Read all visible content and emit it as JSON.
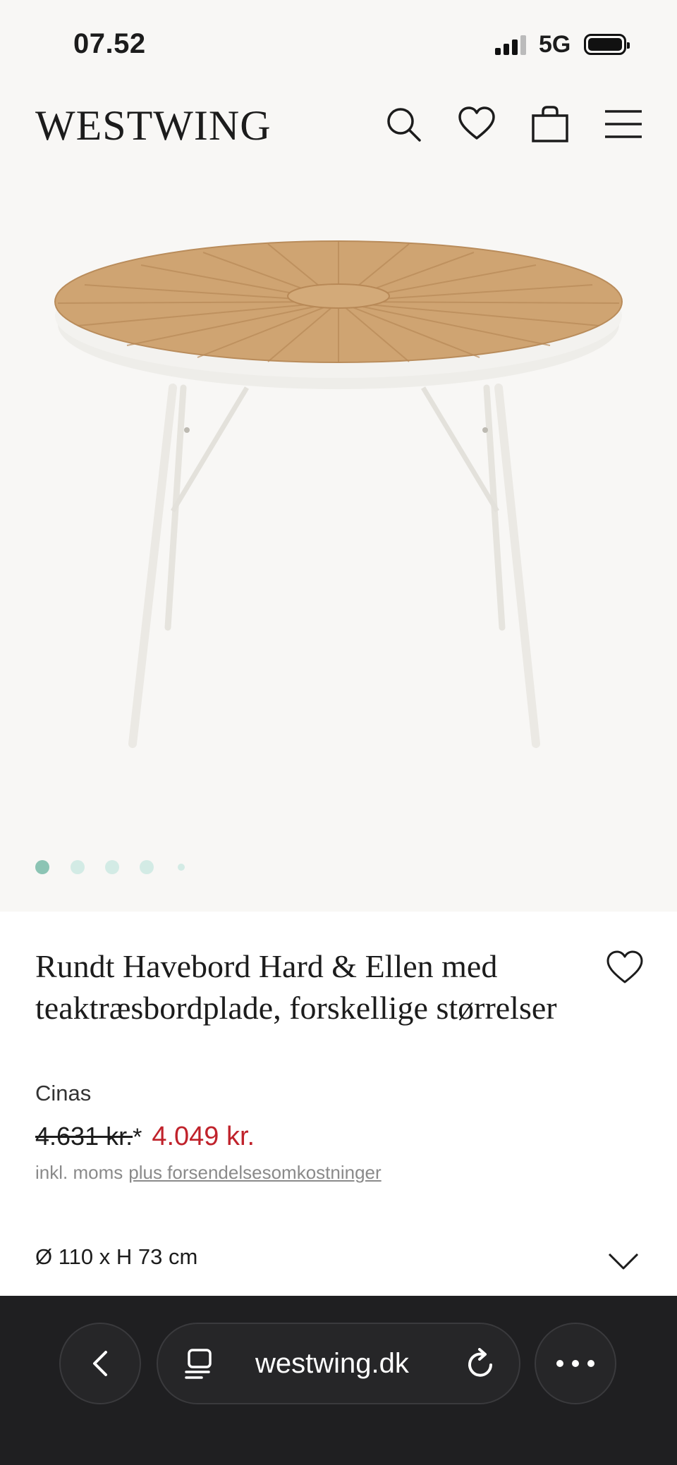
{
  "status_bar": {
    "time": "07.52",
    "network": "5G"
  },
  "header": {
    "logo": "WESTWING",
    "icons": [
      "search-icon",
      "heart-icon",
      "bag-icon",
      "menu-icon"
    ]
  },
  "gallery": {
    "image_count": 5,
    "active_index": 0
  },
  "product": {
    "title": "Rundt Havebord Hard & Ellen med teaktræsbordplade, forskellige størrelser",
    "brand": "Cinas",
    "old_price": "4.631 kr.",
    "old_price_marker": "*",
    "new_price": "4.049 kr.",
    "tax_note": "inkl. moms",
    "shipping_link": "plus forsendelsesomkostninger",
    "size": "Ø 110 x H 73 cm"
  },
  "browser": {
    "url": "westwing.dk"
  },
  "colors": {
    "price_sale": "#c0222b",
    "dot_active": "#8cc4b4",
    "dot_inactive": "#d3ebe5",
    "browser_bg": "#1f1f21"
  }
}
